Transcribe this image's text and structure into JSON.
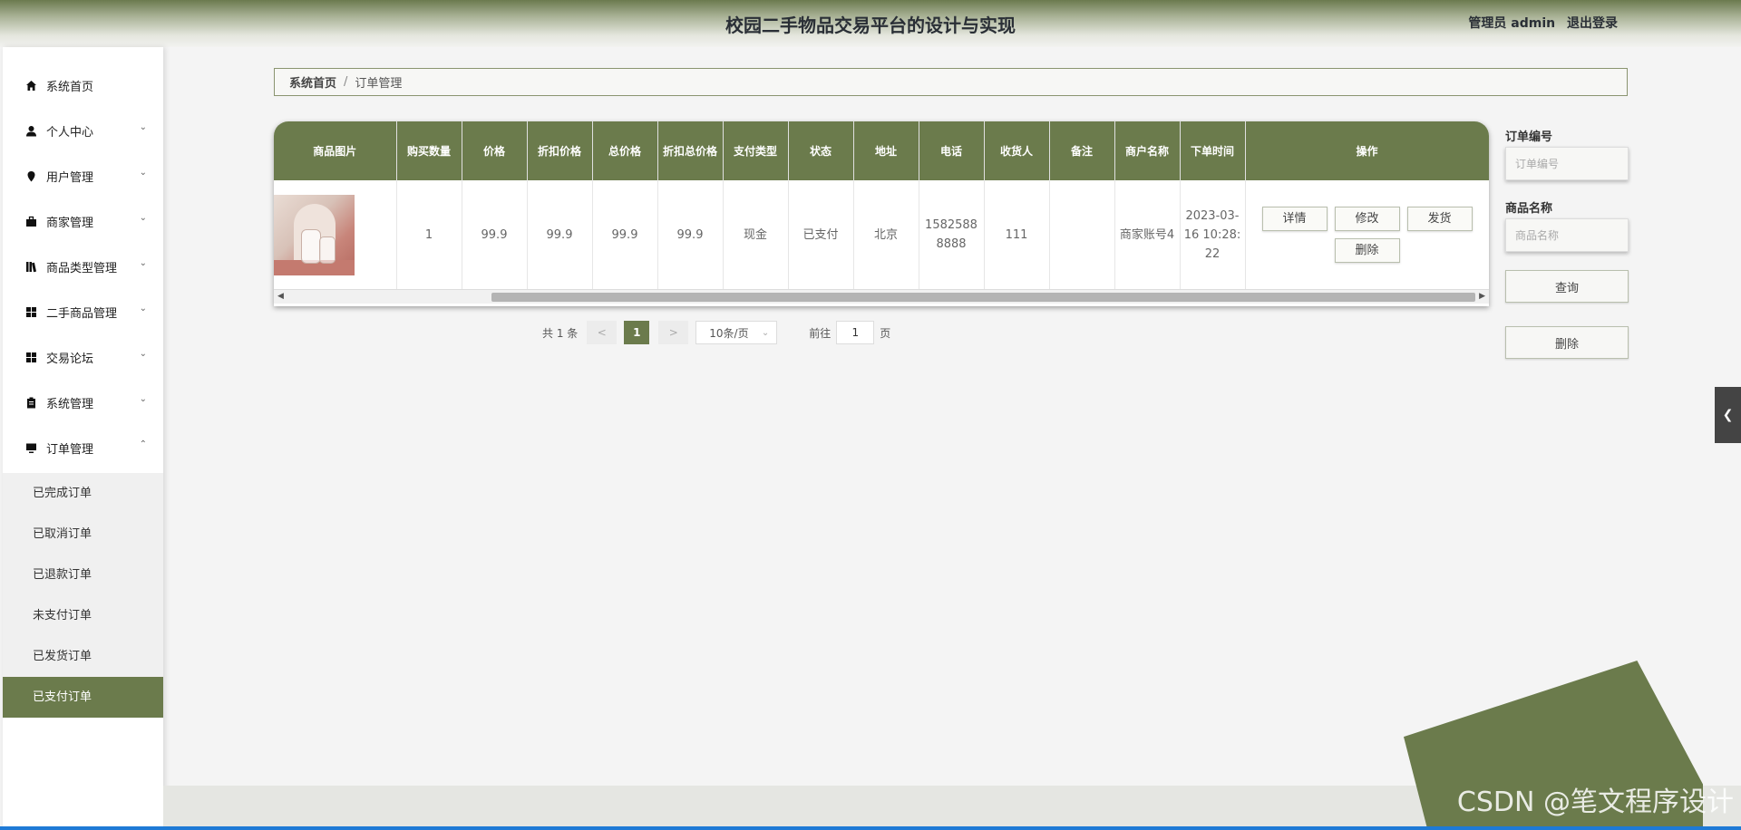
{
  "header": {
    "title": "校园二手物品交易平台的设计与实现",
    "user_label": "管理员 admin",
    "logout_label": "退出登录"
  },
  "sidebar": {
    "items": [
      {
        "label": "系统首页",
        "icon": "home-icon",
        "has_children": false
      },
      {
        "label": "个人中心",
        "icon": "user-icon",
        "has_children": true
      },
      {
        "label": "用户管理",
        "icon": "location-pin-icon",
        "has_children": true
      },
      {
        "label": "商家管理",
        "icon": "briefcase-icon",
        "has_children": true
      },
      {
        "label": "商品类型管理",
        "icon": "library-icon",
        "has_children": true
      },
      {
        "label": "二手商品管理",
        "icon": "grid-icon",
        "has_children": true
      },
      {
        "label": "交易论坛",
        "icon": "grid-icon",
        "has_children": true
      },
      {
        "label": "系统管理",
        "icon": "clipboard-icon",
        "has_children": true
      },
      {
        "label": "订单管理",
        "icon": "monitor-icon",
        "has_children": true,
        "expanded": true
      }
    ],
    "submenu": [
      {
        "label": "已完成订单",
        "active": false
      },
      {
        "label": "已取消订单",
        "active": false
      },
      {
        "label": "已退款订单",
        "active": false
      },
      {
        "label": "未支付订单",
        "active": false
      },
      {
        "label": "已发货订单",
        "active": false
      },
      {
        "label": "已支付订单",
        "active": true
      }
    ]
  },
  "breadcrumb": {
    "home": "系统首页",
    "separator": "/",
    "current": "订单管理"
  },
  "table": {
    "columns": [
      "商品图片",
      "购买数量",
      "价格",
      "折扣价格",
      "总价格",
      "折扣总价格",
      "支付类型",
      "状态",
      "地址",
      "电话",
      "收货人",
      "备注",
      "商户名称",
      "下单时间",
      "操作"
    ],
    "rows": [
      {
        "quantity": "1",
        "price": "99.9",
        "discount_price": "99.9",
        "total_price": "99.9",
        "discount_total": "99.9",
        "pay_type": "现金",
        "status": "已支付",
        "address": "北京",
        "phone": "15825888888",
        "receiver": "111",
        "remark": "",
        "merchant": "商家账号4",
        "order_time": "2023-03-16 10:28:22"
      }
    ],
    "actions": {
      "detail": "详情",
      "edit": "修改",
      "ship": "发货",
      "delete": "删除"
    }
  },
  "pagination": {
    "total_text": "共 1 条",
    "prev": "<",
    "current_page": "1",
    "next": ">",
    "page_size": "10条/页",
    "goto_label": "前往",
    "goto_value": "1",
    "page_unit": "页"
  },
  "search": {
    "order_no_label": "订单编号",
    "order_no_placeholder": "订单编号",
    "goods_name_label": "商品名称",
    "goods_name_placeholder": "商品名称",
    "query_button": "查询",
    "delete_button": "删除"
  },
  "watermark": "CSDN @笔文程序设计",
  "colors": {
    "accent": "#6b7b4c",
    "header_gradient_top": "#6b7a4e"
  }
}
